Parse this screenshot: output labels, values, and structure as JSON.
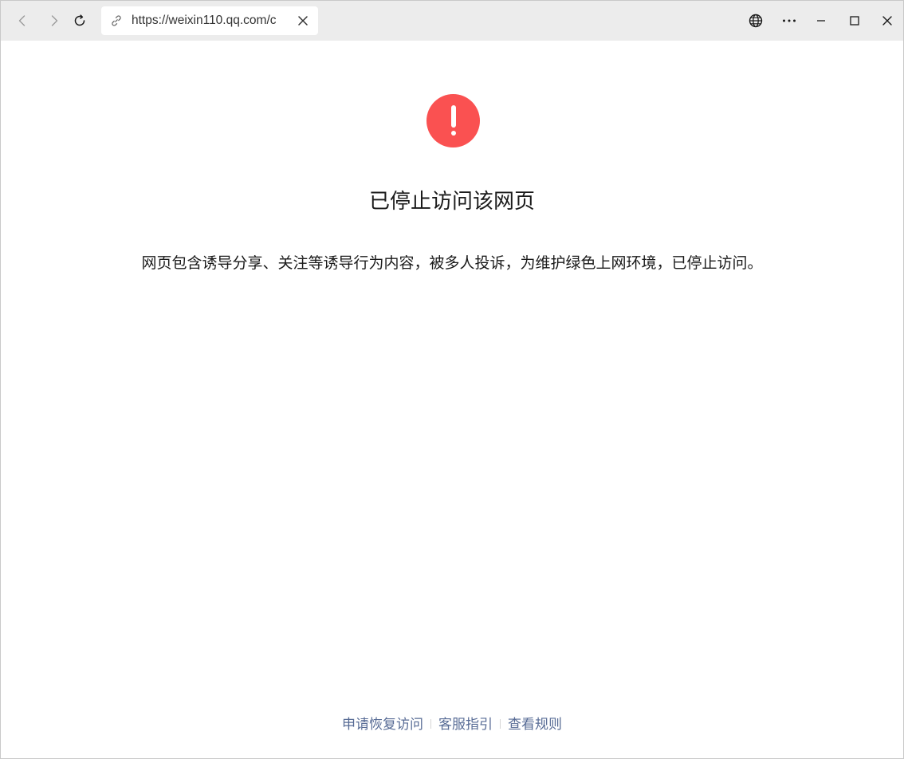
{
  "browser": {
    "url": "https://weixin110.qq.com/c",
    "icons": {
      "back": "chevron-left-icon",
      "forward": "chevron-right-icon",
      "reload": "reload-icon",
      "link": "link-icon",
      "clear": "close-icon",
      "language": "globe-icon",
      "more": "more-horizontal-icon",
      "minimize": "minimize-icon",
      "maximize": "maximize-icon",
      "close": "close-icon"
    }
  },
  "page": {
    "icon": "warning-exclamation-icon",
    "icon_color": "#fa5151",
    "title": "已停止访问该网页",
    "description": "网页包含诱导分享、关注等诱导行为内容，被多人投诉，为维护绿色上网环境，已停止访问。",
    "link_color": "#576b95"
  },
  "footer": {
    "links": [
      {
        "label": "申请恢复访问"
      },
      {
        "label": "客服指引"
      },
      {
        "label": "查看规则"
      }
    ]
  }
}
